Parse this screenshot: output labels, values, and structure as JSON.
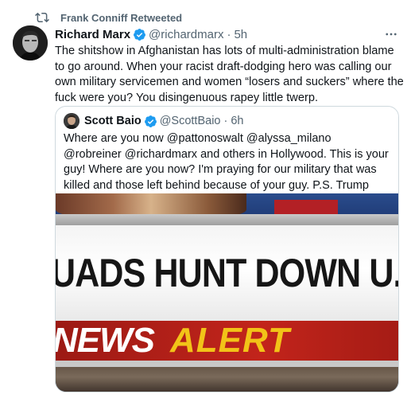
{
  "retweet": {
    "icon": "retweet-icon",
    "label": "Frank Conniff Retweeted"
  },
  "tweet": {
    "author_name": "Richard Marx",
    "author_handle": "@richardmarx",
    "separator": "·",
    "time": "5h",
    "more_icon": "more-icon",
    "text": "The shitshow in Afghanistan has lots of multi-administration blame to go around. When your racist draft-dodging hero was calling our own military servicemen and women “losers and suckers” where the fuck were you? You disingenuous rapey little twerp."
  },
  "quote": {
    "author_name": "Scott Baio",
    "author_handle": "@ScottBaio",
    "separator": "·",
    "time": "6h",
    "text": "Where are you now @pattonoswalt @alyssa_milano @robreiner @richardmarx and others in Hollywood.  This is your guy! Where are you now? I'm praying for our military that was killed and those left behind because of your guy. P.S. Trump has nothing to do with this.",
    "media": {
      "headline": "UADS HUNT DOWN U.S.",
      "alert_left": "NEWS",
      "alert_right": "ALERT"
    }
  },
  "colors": {
    "verified": "#1d9bf0",
    "muted": "#536471",
    "alert_red": "#c2241b",
    "alert_yellow": "#f2c318"
  }
}
